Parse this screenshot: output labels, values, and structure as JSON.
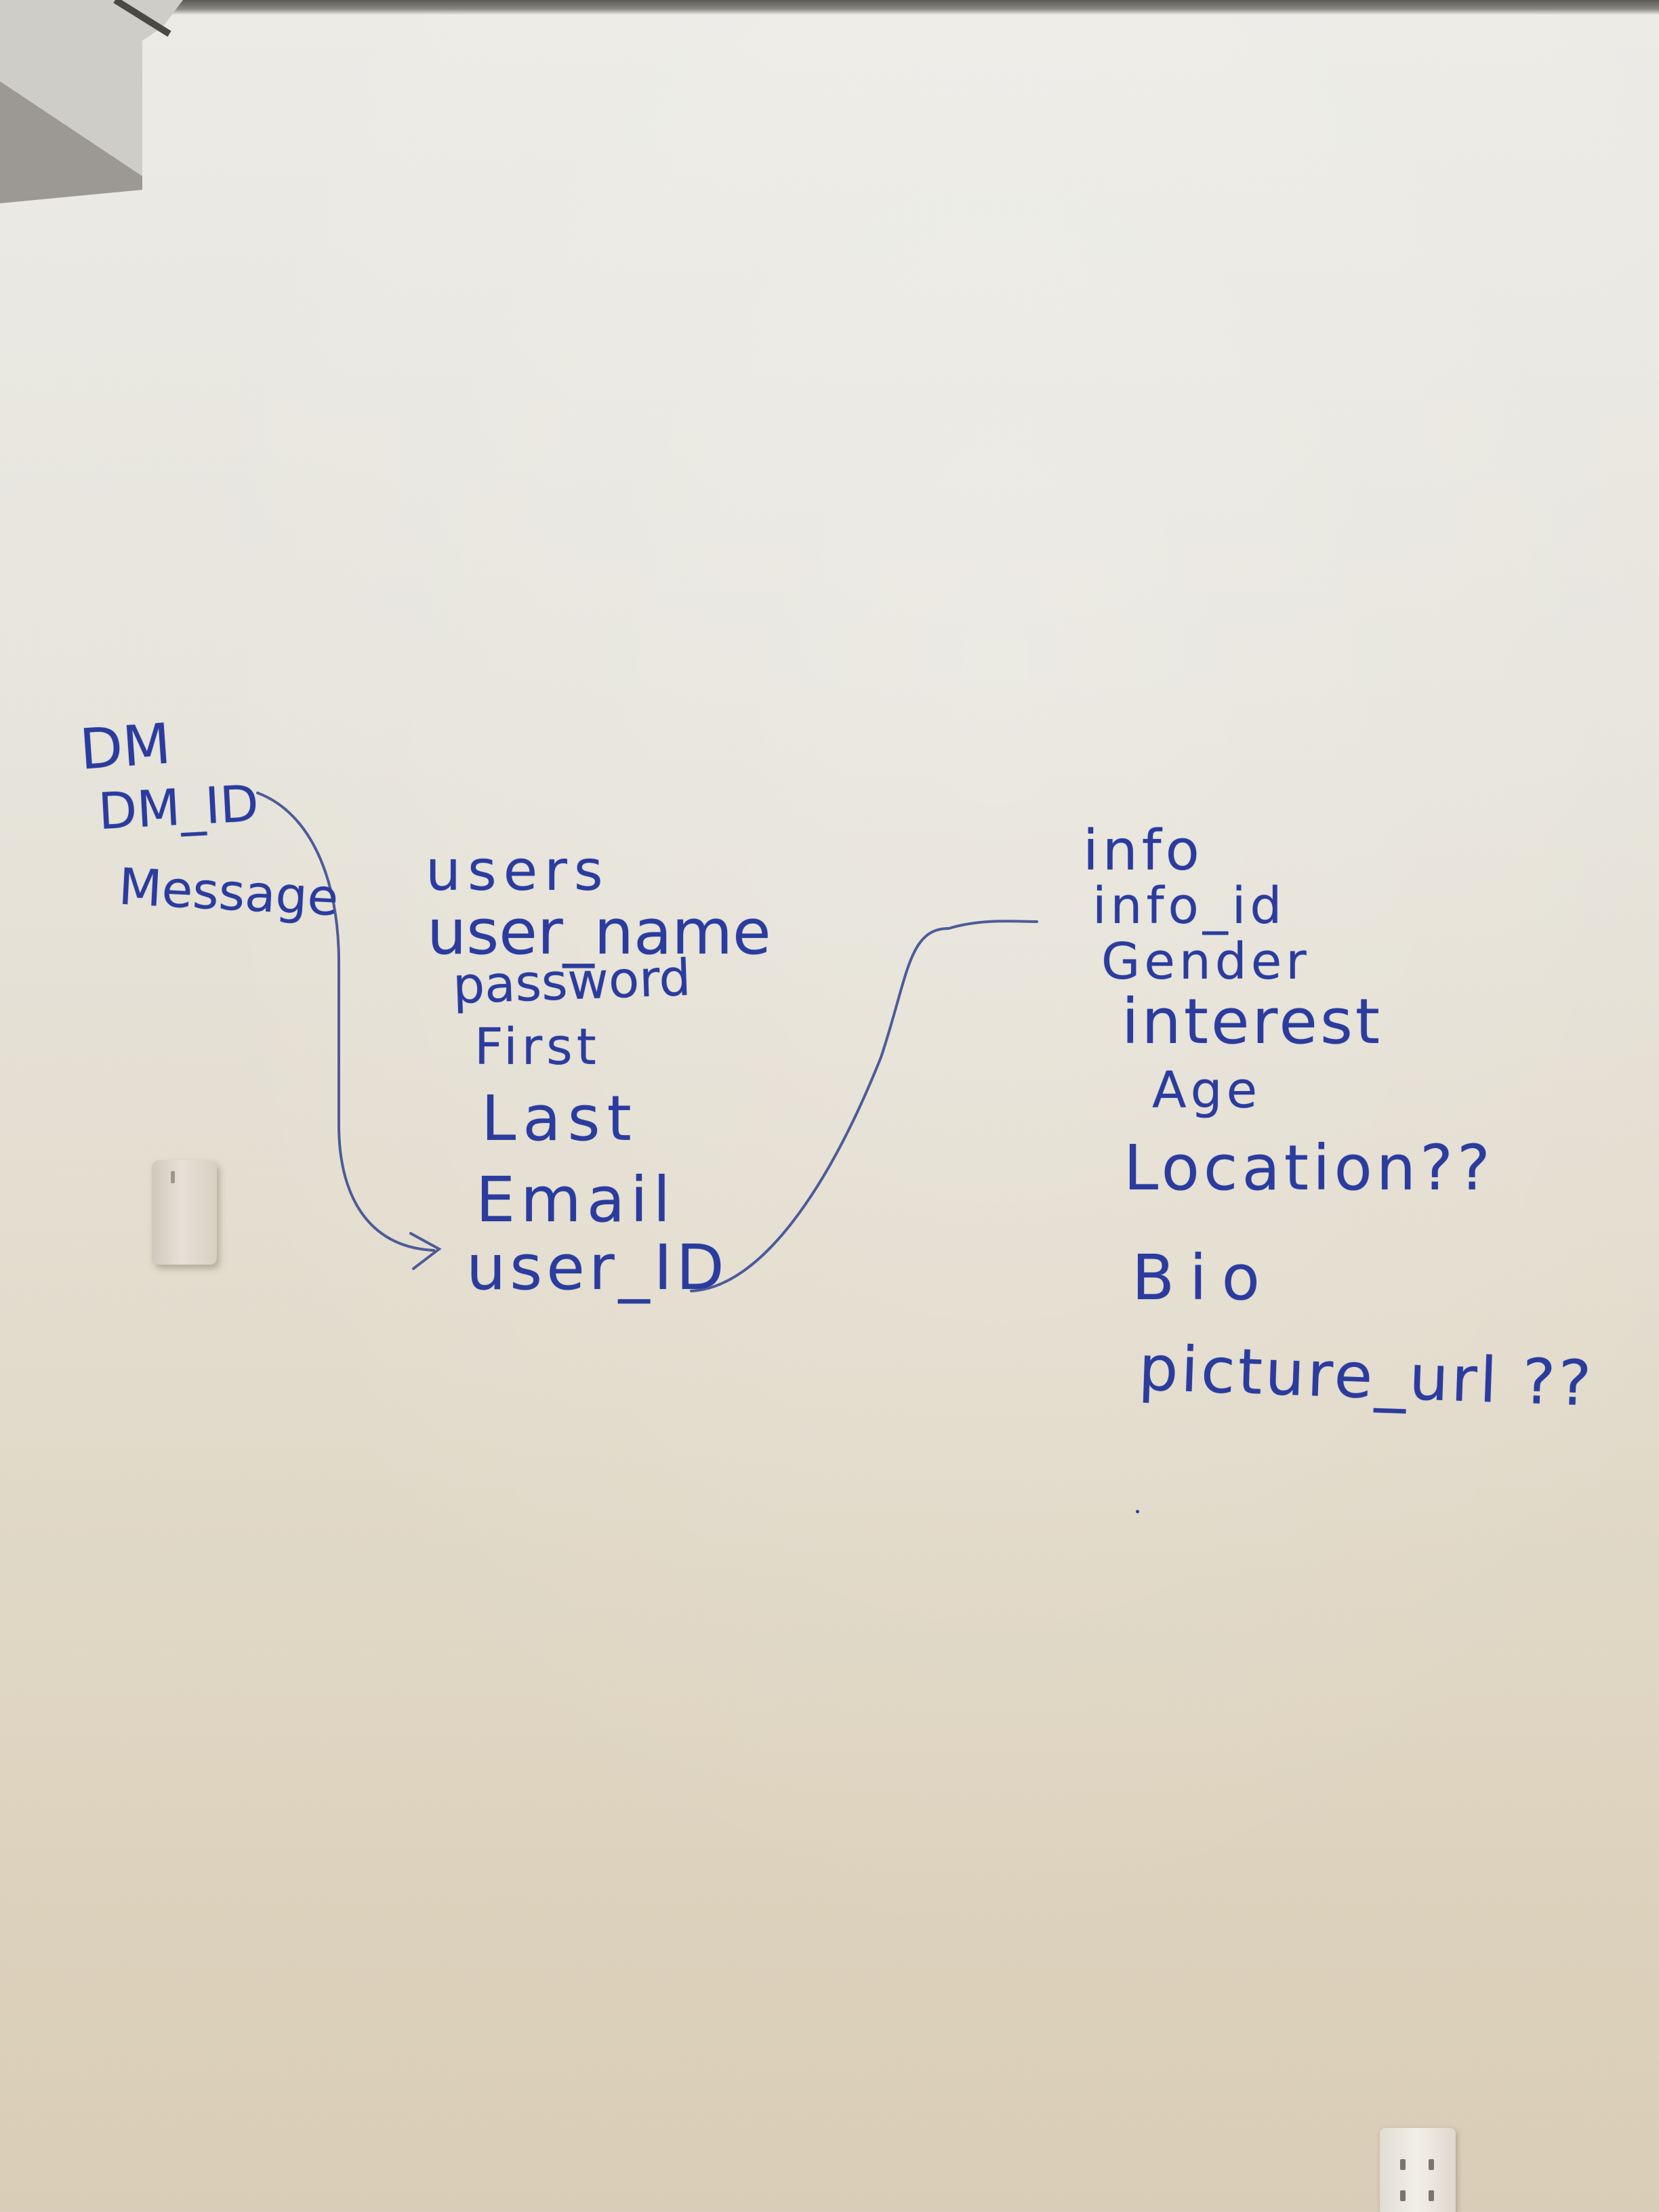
{
  "diagram": {
    "tables": [
      {
        "name": "DM",
        "fields": [
          "DM_ID",
          "Message"
        ]
      },
      {
        "name": "users",
        "fields": [
          "user_name",
          "password",
          "First",
          "Last",
          "Email",
          "user_ID"
        ]
      },
      {
        "name": "info",
        "fields": [
          "info_id",
          "Gender",
          "interest",
          "Age",
          "Location??",
          "Bio",
          "picture_url ??"
        ]
      }
    ],
    "links": [
      {
        "from": "DM.DM_ID",
        "to": "users.user_ID"
      },
      {
        "from": "users.user_ID",
        "to": "info.info_id"
      }
    ],
    "ink_color": "#2b3c9e",
    "wall_color": "#e7e5dd"
  }
}
